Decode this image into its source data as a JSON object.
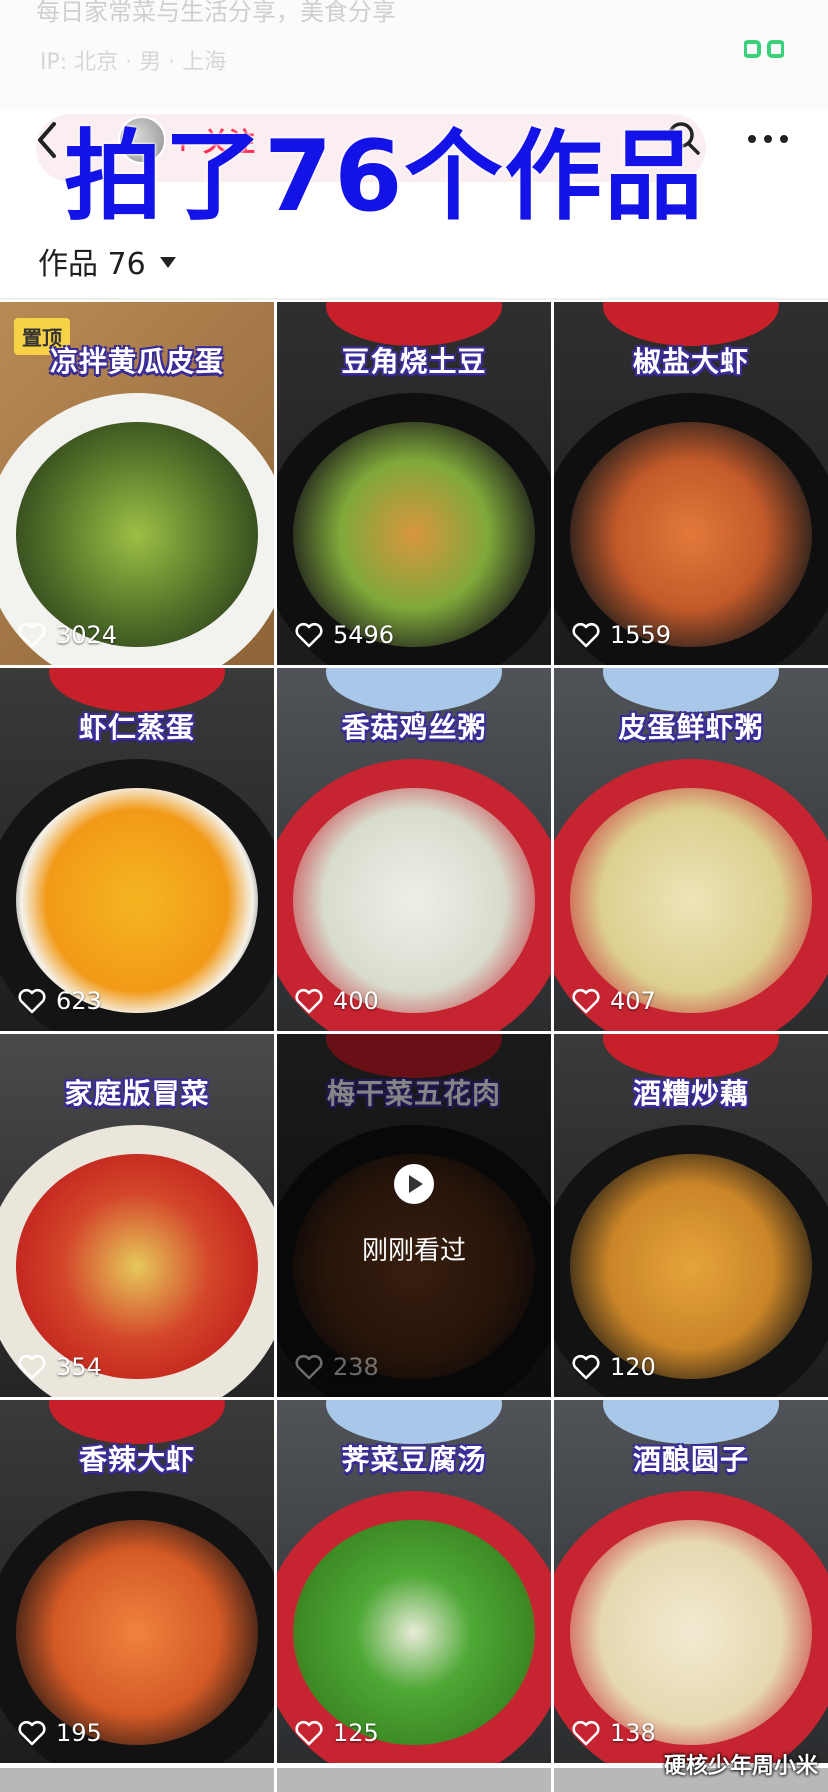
{
  "header": {
    "bio": "每日家常菜与生活分享，美食分享",
    "stats": "IP: 北京 · 男 · 上海",
    "follow_label": "+ 关注"
  },
  "overlay_title": "拍了76个作品",
  "tab": {
    "label": "作品 76"
  },
  "pinned_label": "置顶",
  "recently_viewed_label": "刚刚看过",
  "watermark": "硬核少年周小米",
  "videos": [
    {
      "title": "凉拌黄瓜皮蛋",
      "likes": "3024"
    },
    {
      "title": "豆角烧土豆",
      "likes": "5496"
    },
    {
      "title": "椒盐大虾",
      "likes": "1559"
    },
    {
      "title": "虾仁蒸蛋",
      "likes": "623"
    },
    {
      "title": "香菇鸡丝粥",
      "likes": "400"
    },
    {
      "title": "皮蛋鲜虾粥",
      "likes": "407"
    },
    {
      "title": "家庭版冒菜",
      "likes": "354"
    },
    {
      "title": "梅干菜五花肉",
      "likes": "238"
    },
    {
      "title": "酒糟炒藕",
      "likes": "120"
    },
    {
      "title": "香辣大虾",
      "likes": "195"
    },
    {
      "title": "荠菜豆腐汤",
      "likes": "125"
    },
    {
      "title": "酒酿圆子",
      "likes": "138"
    }
  ],
  "colors": {
    "accent": "#fe2c55",
    "overlay_text": "#1313e8",
    "pinned_badge": "#f7d247"
  },
  "icons": [
    "back-arrow-icon",
    "search-icon",
    "more-dots-icon",
    "heart-icon",
    "play-icon",
    "caret-down-icon"
  ]
}
